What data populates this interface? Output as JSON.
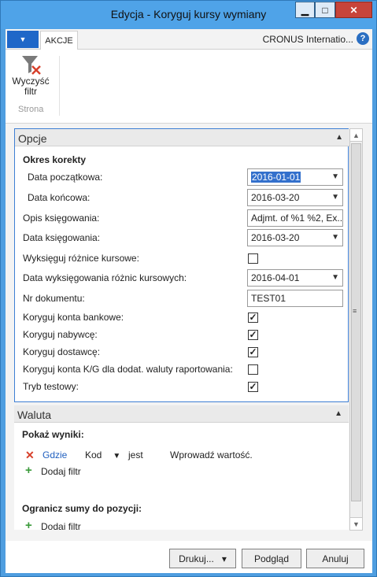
{
  "window": {
    "title": "Edycja - Koryguj kursy wymiany",
    "minimize": "▁",
    "maximize": "□",
    "close": "✕"
  },
  "ribbon": {
    "app_menu_glyph": "▼",
    "tab_actions": "AKCJE",
    "company": "CRONUS Internatio...",
    "help": "?",
    "clear_filter_line1": "Wyczyść",
    "clear_filter_line2": "filtr",
    "group_label": "Strona"
  },
  "opcje": {
    "header": "Opcje",
    "section": "Okres korekty",
    "fields": {
      "start_date_label": "Data początkowa:",
      "start_date_value": "2016-01-01",
      "end_date_label": "Data końcowa:",
      "end_date_value": "2016-03-20",
      "posting_desc_label": "Opis księgowania:",
      "posting_desc_value": "Adjmt. of %1 %2, Ex...",
      "posting_date_label": "Data księgowania:",
      "posting_date_value": "2016-03-20",
      "post_diff_label": "Wyksięguj różnice kursowe:",
      "post_diff_checked": false,
      "diff_post_date_label": "Data wyksięgowania różnic kursowych:",
      "diff_post_date_value": "2016-04-01",
      "doc_no_label": "Nr dokumentu:",
      "doc_no_value": "TEST01",
      "adj_bank_label": "Koryguj konta bankowe:",
      "adj_bank_checked": true,
      "adj_customers_label": "Koryguj nabywcę:",
      "adj_customers_checked": true,
      "adj_vendors_label": "Koryguj dostawcę:",
      "adj_vendors_checked": true,
      "adj_gl_label": "Koryguj konta K/G dla dodat. waluty raportowania:",
      "adj_gl_checked": false,
      "test_mode_label": "Tryb testowy:",
      "test_mode_checked": true
    }
  },
  "waluta": {
    "header": "Waluta",
    "show_results": "Pokaż wyniki:",
    "where": "Gdzie",
    "field": "Kod",
    "operator": "jest",
    "value_placeholder": "Wprowadź wartość.",
    "add_filter": "Dodaj filtr",
    "limit_totals": "Ogranicz sumy do pozycji:",
    "add_filter_2": "Dodaj filtr"
  },
  "footer": {
    "print": "Drukuj...",
    "print_arrow": "▾",
    "preview": "Podgląd",
    "cancel": "Anuluj"
  },
  "colors": {
    "accent": "#3e7fd4",
    "title_bar": "#4fa3e8",
    "close": "#c7443a",
    "link": "#1f5fbf"
  }
}
